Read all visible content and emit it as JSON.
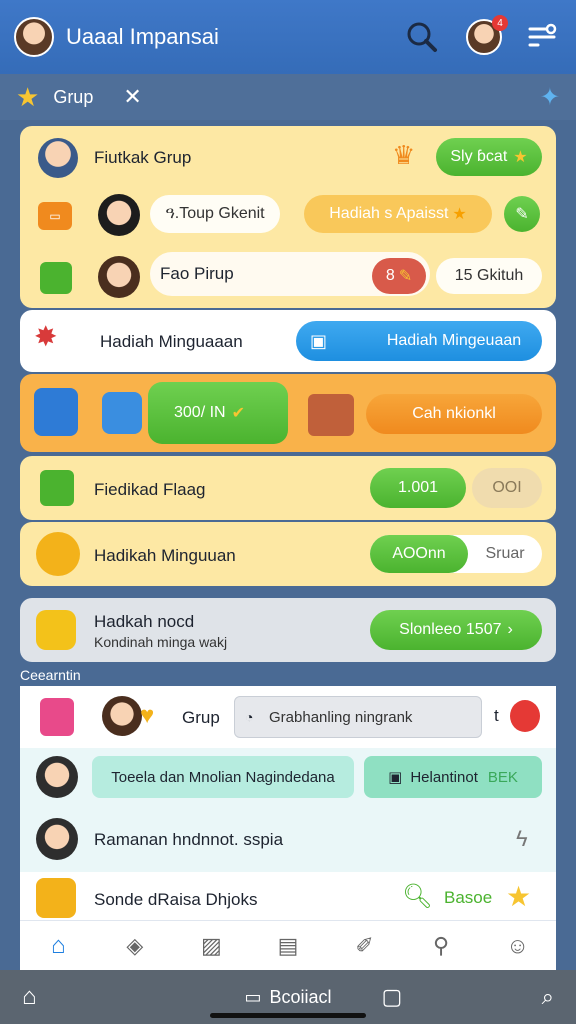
{
  "appbar": {
    "title": "Uaaal Impansai",
    "notification_count": "4"
  },
  "subbar": {
    "label": "Grup"
  },
  "group_card": {
    "row1": {
      "label": "Fiutkak Grup",
      "button": "Sly ɓcat"
    },
    "row2": {
      "name_pill": "ዓ.Toup Gkenit",
      "reward_pill": "Hadiah s Apaisst"
    },
    "row3": {
      "input_value": "Fao Pirup",
      "badge": "8",
      "status_pill": "15 Gkituh"
    }
  },
  "weekly_card": {
    "label": "Hadiah Minguaaan",
    "button": "Hadiah Mingeuaan"
  },
  "orange_card": {
    "progress": "300/ IN",
    "button": "Cah nkionkl"
  },
  "flag_card": {
    "label": "Fiedikad Flaag",
    "value_pill": "1.001",
    "secondary_pill": "OOI"
  },
  "minguan_card": {
    "label": "Hadikah Minguuan",
    "toggle_on": "AOOnn",
    "toggle_off": "Sruar"
  },
  "grey_card": {
    "title": "Hadkah nocd",
    "subtitle": "Kondinah minga wakj",
    "button": "Slonleeo 1507"
  },
  "section": {
    "label": "Ceearntin"
  },
  "list": {
    "row1": {
      "label": "Grup",
      "search_placeholder": "Grabhanling ningrank",
      "status_letter": "t"
    },
    "row2": {
      "chip1": "Toeela dan Mnolian Nagindedana",
      "chip2": "Helantinot",
      "chip2_suffix": "BEK"
    },
    "row3": {
      "label": "Ramanan hndnnot. sspia"
    },
    "row4": {
      "label": "Sonde dRaisa Dhjoks",
      "button": "Basoe"
    }
  },
  "sysbar": {
    "center_label": "Bcoiiacl"
  },
  "colors": {
    "appbar": "#3f78c8",
    "card_yellow": "#fde8a4",
    "accent_green": "#4bb32f",
    "accent_orange": "#f08a1e",
    "accent_blue": "#1e8fe0"
  },
  "icons": [
    "search-icon",
    "avatar",
    "filter-icon",
    "star-icon",
    "compass-icon",
    "home-icon",
    "profile-icon"
  ]
}
